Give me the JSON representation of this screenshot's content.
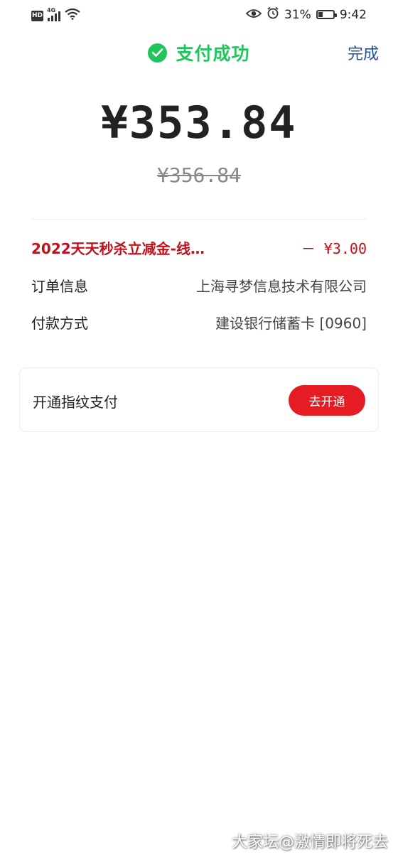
{
  "status_bar": {
    "hd": "HD",
    "network": "4G",
    "battery_percent_text": "31%",
    "battery_level": 0.31,
    "time": "9:42"
  },
  "header": {
    "title": "支付成功",
    "done_label": "完成",
    "accent_color": "#1fc65c"
  },
  "payment": {
    "amount": "¥353.84",
    "original_amount": "¥356.84"
  },
  "details": {
    "discount_label": "2022天天秒杀立减金-线…",
    "discount_value": "－ ¥3.00",
    "order_label": "订单信息",
    "order_value": "上海寻梦信息技术有限公司",
    "method_label": "付款方式",
    "method_value": "建设银行储蓄卡 [0960]",
    "discount_color": "#c1121c"
  },
  "fingerprint": {
    "label": "开通指纹支付",
    "button_label": "去开通",
    "button_color": "#e51c23"
  },
  "watermark": "大家坛@激情即将死去"
}
